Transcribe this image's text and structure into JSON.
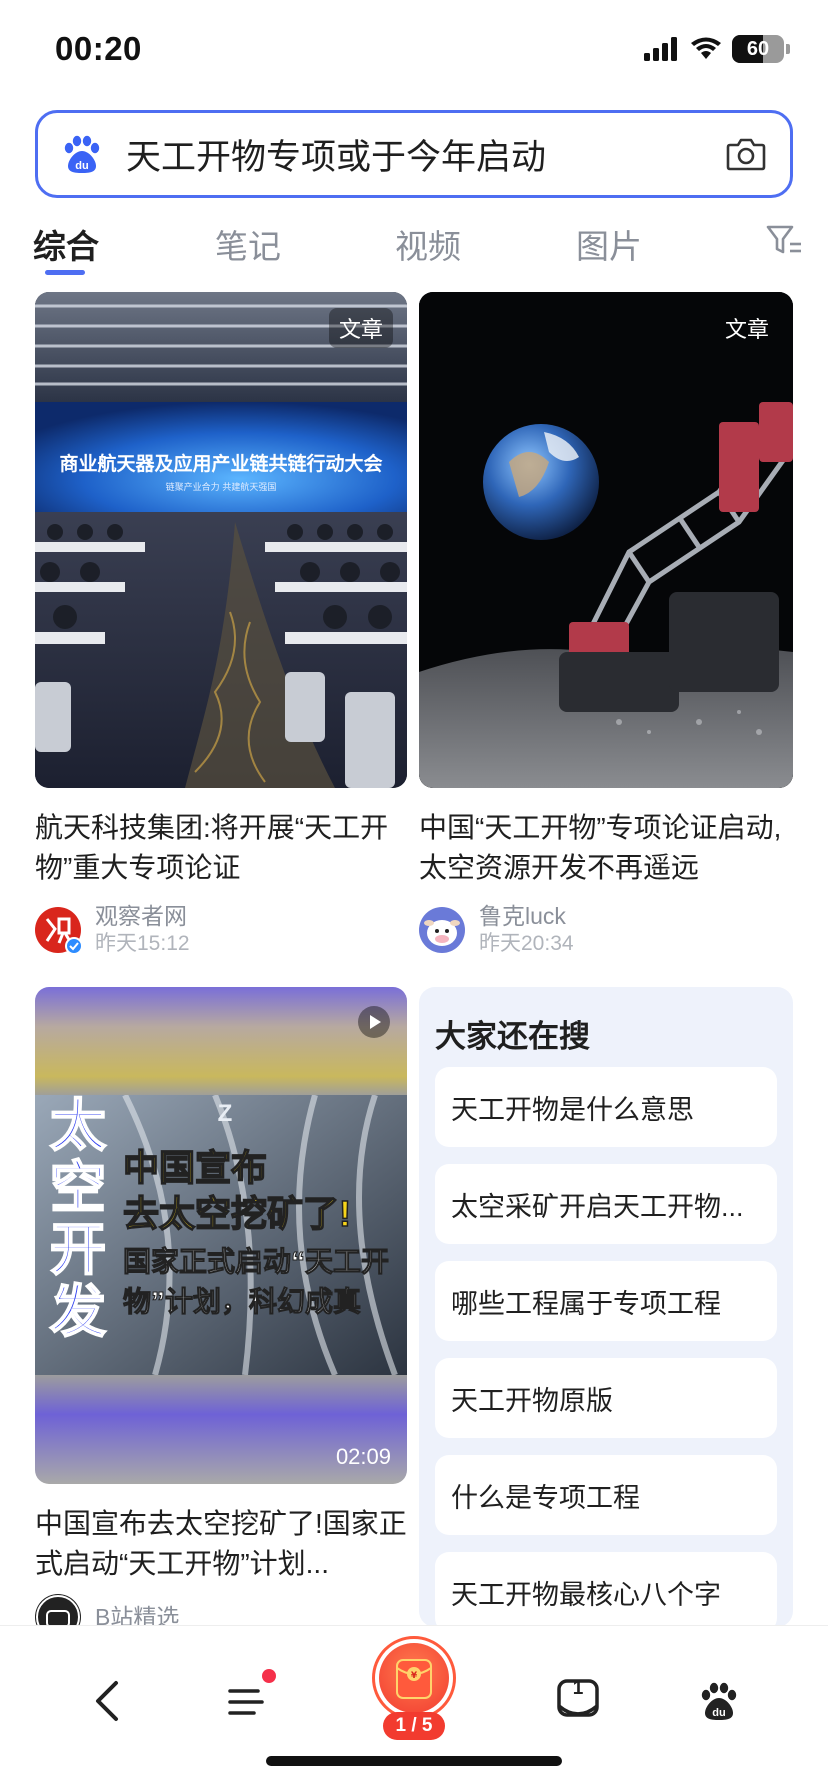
{
  "status_bar": {
    "time": "00:20",
    "battery": "60",
    "battery_level": 0.6
  },
  "search": {
    "query": "天工开物专项或于今年启动"
  },
  "tabs": [
    {
      "label": "综合",
      "active": true
    },
    {
      "label": "笔记",
      "active": false
    },
    {
      "label": "视频",
      "active": false
    },
    {
      "label": "图片",
      "active": false
    }
  ],
  "cards": [
    {
      "tag": "文章",
      "image_caption": "商业航天器及应用产业链共链行动大会",
      "image_subcaption": "链聚产业合力 共建航天强国",
      "title": "航天科技集团:将开展“天工开物”重大专项论证",
      "author": "观察者网",
      "time": "昨天15:12"
    },
    {
      "tag": "文章",
      "title": "中国“天工开物”专项论证启动,太空资源开发不再遥远",
      "author": "鲁克luck",
      "time": "昨天20:34"
    },
    {
      "duration": "02:09",
      "overlay_big": [
        "太",
        "空",
        "开",
        "发"
      ],
      "overlay_line1": "中国宣布",
      "overlay_line2": "去太空挖矿了!",
      "overlay_line3": "国家正式启动“天工开",
      "overlay_line4": "物”计划，科幻成真",
      "title": "中国宣布去太空挖矿了!国家正式启动“天工开物”计划...",
      "author": "B站精选"
    }
  ],
  "also_search": {
    "title": "大家还在搜",
    "items": [
      "天工开物是什么意思",
      "太空采矿开启天工开物...",
      "哪些工程属于专项工程",
      "天工开物原版",
      "什么是专项工程",
      "天工开物最核心八个字"
    ]
  },
  "bottom_nav": {
    "tab_count": "1",
    "red_packet_progress": "1 / 5"
  },
  "colors": {
    "accent": "#4e6ef2",
    "red": "#f23b2f"
  }
}
